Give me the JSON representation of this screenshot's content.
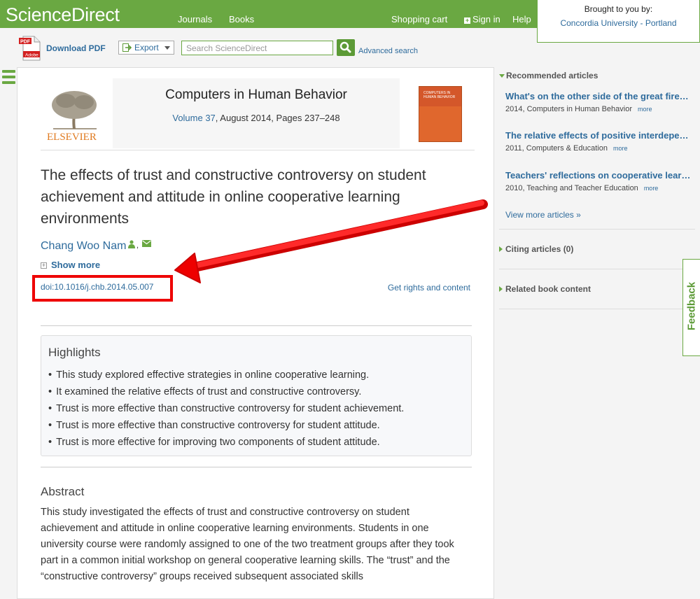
{
  "header": {
    "logo": "ScienceDirect",
    "nav": [
      "Journals",
      "Books"
    ],
    "shopping_cart": "Shopping cart",
    "sign_in": "Sign in",
    "help": "Help",
    "brought_to_you_by": "Brought to you by:",
    "institution": "Concordia University - Portland"
  },
  "toolbar": {
    "download_pdf": "Download PDF",
    "export": "Export",
    "search_placeholder": "Search ScienceDirect",
    "advanced_search": "Advanced search"
  },
  "journal": {
    "publisher_logo_text": "ELSEVIER",
    "title": "Computers in Human Behavior",
    "volume_link": "Volume 37",
    "volume_details": ", August 2014, Pages 237–248",
    "cover_text": "COMPUTERS IN HUMAN BEHAVIOR"
  },
  "article": {
    "title": "The effects of trust and constructive controversy on student achievement and attitude in online cooperative learning environments",
    "author": "Chang Woo Nam",
    "author_separator": ",",
    "show_more": "Show more",
    "doi": "doi:10.1016/j.chb.2014.05.007",
    "rights": "Get rights and content"
  },
  "highlights": {
    "title": "Highlights",
    "items": [
      "This study explored effective strategies in online cooperative learning.",
      "It examined the relative effects of trust and constructive controversy.",
      "Trust is more effective than constructive controversy for student achievement.",
      "Trust is more effective than constructive controversy for student attitude.",
      "Trust is more effective for improving two components of student attitude."
    ]
  },
  "abstract": {
    "title": "Abstract",
    "text": "This study investigated the effects of trust and constructive controversy on student achievement and attitude in online cooperative learning environments. Students in one university course were randomly assigned to one of the two treatment groups after they took part in a common initial workshop on general cooperative learning skills. The “trust” and the “constructive controversy” groups received subsequent associated skills"
  },
  "sidebar": {
    "recommended_header": "Recommended articles",
    "articles": [
      {
        "title": "What's on the other side of the great firewall?",
        "meta": "2014, Computers in Human Behavior",
        "more": "more"
      },
      {
        "title": "The relative effects of positive interdependence and group processing",
        "meta": "2011, Computers & Education",
        "more": "more"
      },
      {
        "title": "Teachers' reflections on cooperative learning",
        "meta": "2010, Teaching and Teacher Education",
        "more": "more"
      }
    ],
    "view_more": "View more articles »",
    "citing_articles": "Citing articles (0)",
    "related_book_content": "Related book content"
  },
  "feedback": "Feedback",
  "colors": {
    "brand_green": "#6aa842",
    "link_blue": "#2e6b9c",
    "annotation_red": "#e00000"
  }
}
